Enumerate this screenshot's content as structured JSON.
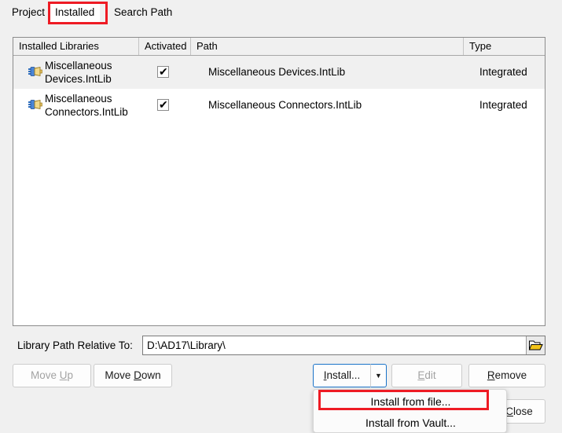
{
  "tabs": [
    {
      "label": "Project",
      "active": false
    },
    {
      "label": "Installed",
      "active": true
    },
    {
      "label": "Search Path",
      "active": false
    }
  ],
  "table": {
    "columns": [
      "Installed Libraries",
      "Activated",
      "Path",
      "Type"
    ],
    "rows": [
      {
        "library": "Miscellaneous Devices.IntLib",
        "library_line1": "Miscellaneous",
        "library_line2": "Devices.IntLib",
        "activated": true,
        "activated_glyph": "✔",
        "path": "Miscellaneous Devices.IntLib",
        "type": "Integrated",
        "selected": true,
        "icon": "connector-icon"
      },
      {
        "library": "Miscellaneous Connectors.IntLib",
        "library_line1": "Miscellaneous",
        "library_line2": "Connectors.IntLib",
        "activated": true,
        "activated_glyph": "✔",
        "path": "Miscellaneous Connectors.IntLib",
        "type": "Integrated",
        "selected": false,
        "icon": "connector-icon"
      }
    ]
  },
  "library_path": {
    "label": "Library Path Relative To:",
    "value": "D:\\AD17\\Library\\",
    "placeholder": "",
    "browse_icon": "open-folder-icon"
  },
  "buttons": {
    "move_up": {
      "label": "Move Up",
      "accel": "U",
      "disabled": true
    },
    "move_down": {
      "label": "Move Down",
      "accel": "D",
      "disabled": false
    },
    "install": {
      "label": "Install...",
      "accel": "I",
      "disabled": false,
      "focused": true
    },
    "install_arrow": {
      "glyph": "▼"
    },
    "edit": {
      "label": "Edit",
      "accel": "E",
      "disabled": true
    },
    "remove": {
      "label": "Remove",
      "accel": "R",
      "disabled": false
    },
    "close": {
      "label": "Close",
      "accel": "C",
      "disabled": false
    }
  },
  "install_menu": {
    "items": [
      {
        "label": "Install from file...",
        "highlighted": true
      },
      {
        "label": "Install from Vault...",
        "highlighted": false
      }
    ]
  },
  "colors": {
    "highlight_red": "#ee1b24",
    "focus_blue": "#1a73c8",
    "window_bg": "#f0f0f0",
    "panel_bg": "#ffffff",
    "selected_row": "#f0f0f0"
  }
}
